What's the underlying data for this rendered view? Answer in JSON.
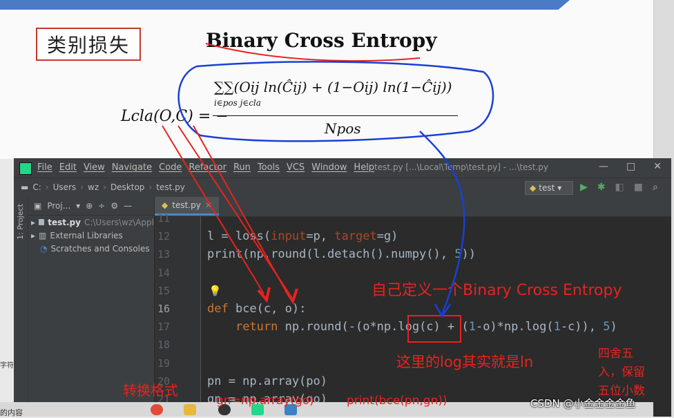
{
  "slide": {
    "cn_label": "类别损失",
    "title": "Binary Cross Entropy",
    "formula": {
      "lhs": "Lcla(O,C) = −",
      "numerator": "∑∑(Oij ln(Ĉij) + (1−Oij) ln(1−Ĉij))",
      "numerator_sub": "i∈pos j∈cla",
      "denominator": "Npos"
    }
  },
  "ide": {
    "menu": [
      "File",
      "Edit",
      "View",
      "Navigate",
      "Code",
      "Refactor",
      "Run",
      "Tools",
      "VCS",
      "Window",
      "Help"
    ],
    "window_title": "test.py [...\\Local\\Temp\\test.py] - ...\\test.py",
    "window_controls": [
      "—",
      "□",
      "✕"
    ],
    "breadcrumbs": [
      "C:",
      "Users",
      "wz",
      "Desktop",
      "test.py"
    ],
    "run_config": "test",
    "side_label": "1: Project",
    "project": {
      "header": "Proj...",
      "items": [
        {
          "name": "test.py",
          "path": "C:\\Users\\wz\\Appl"
        },
        {
          "name": "External Libraries",
          "path": ""
        },
        {
          "name": "Scratches and Consoles",
          "path": ""
        }
      ]
    },
    "tab": "test.py",
    "lines": [
      {
        "n": "11",
        "text": ""
      },
      {
        "n": "12",
        "text": ""
      },
      {
        "n": "13",
        "text": ""
      },
      {
        "n": "14",
        "text": ""
      },
      {
        "n": "15",
        "text": ""
      },
      {
        "n": "16",
        "text": ""
      },
      {
        "n": "17",
        "text": ""
      },
      {
        "n": "18",
        "text": ""
      },
      {
        "n": "19",
        "text": ""
      },
      {
        "n": "20",
        "text": ""
      },
      {
        "n": "21",
        "text": ""
      }
    ],
    "code": {
      "l12_a": "l = loss(",
      "l12_p1": "input",
      "l12_b": "=p, ",
      "l12_p2": "target",
      "l12_c": "=g)",
      "l13_a": "print(np.round(l.detach().numpy(), ",
      "l13_n": "5",
      "l13_b": "))",
      "l16_kw": "def",
      "l16_a": " bce(c, o):",
      "l17_kw": "return",
      "l17_a": " np.round(-(o*np.log(c) + (",
      "l17_n1": "1",
      "l17_b": "-o)*np.log(",
      "l17_n2": "1",
      "l17_c": "-c)), ",
      "l17_n3": "5",
      "l17_d": ")",
      "l20": "pn = np.array(po)",
      "l21": "gn = np.array(go)"
    }
  },
  "annotations": {
    "custom_bce": "自己定义一个Binary Cross Entropy",
    "log_is_ln": "这里的log其实就是ln",
    "round5": [
      "四舍五",
      "入，保留",
      "五位小数"
    ],
    "convert": "转换格式",
    "gn_line": "gn=np.array(go)",
    "print_call": "print(bce(pn,gn))"
  },
  "taskbar_side": {
    "left_text_1": "字符",
    "left_text_2": "的内容"
  },
  "watermark": "CSDN @小金金金金鱼",
  "colors": {
    "annotation_red": "#e8231f",
    "annotation_blue": "#1a3fd6",
    "ide_bg": "#2b2b2b"
  }
}
